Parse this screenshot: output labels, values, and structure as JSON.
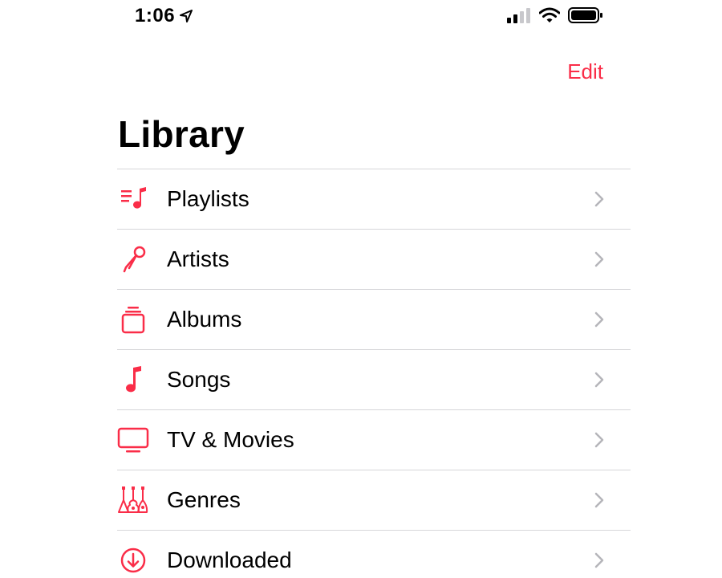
{
  "status_bar": {
    "time": "1:06",
    "location_icon": "location-arrow-icon",
    "signal_icon": "cellular-signal-icon",
    "wifi_icon": "wifi-icon",
    "battery_icon": "battery-icon"
  },
  "nav": {
    "edit_label": "Edit"
  },
  "title": "Library",
  "accent_color": "#fa2d48",
  "items": [
    {
      "label": "Playlists",
      "icon": "playlist-icon"
    },
    {
      "label": "Artists",
      "icon": "microphone-icon"
    },
    {
      "label": "Albums",
      "icon": "albums-icon"
    },
    {
      "label": "Songs",
      "icon": "music-note-icon"
    },
    {
      "label": "TV & Movies",
      "icon": "tv-icon"
    },
    {
      "label": "Genres",
      "icon": "guitars-icon"
    },
    {
      "label": "Downloaded",
      "icon": "download-circle-icon"
    }
  ]
}
